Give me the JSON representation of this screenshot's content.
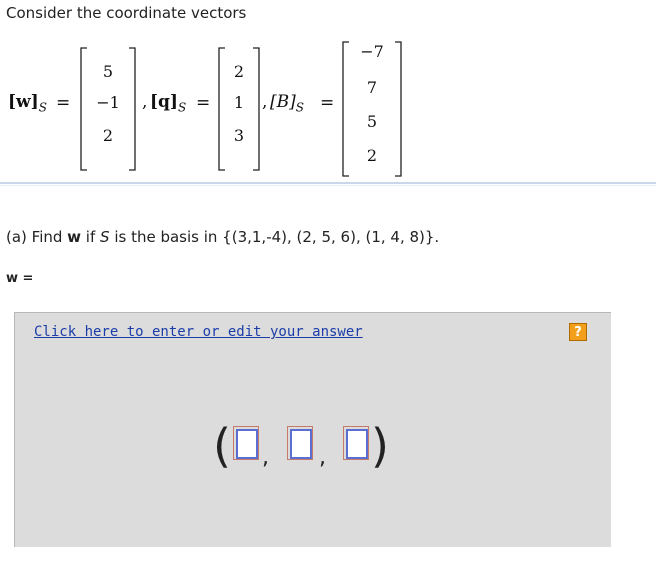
{
  "intro": "Consider the coordinate vectors",
  "vectors": {
    "w_label": "[w]",
    "w_sub": "S",
    "w": [
      "5",
      "−1",
      "2"
    ],
    "q_label": "[q]",
    "q_sub": "S",
    "q": [
      "2",
      "1",
      "3"
    ],
    "b_label": "[B]",
    "b_sub": "S",
    "b": [
      "−7",
      "7",
      "5",
      "2"
    ],
    "equals": "=",
    "comma": ","
  },
  "question": {
    "prefix": "(a) Find ",
    "bold": "w",
    "middle": " if ",
    "italic": "S",
    "suffix": " is the basis in {(3,1,-4), (2, 5, 6), (1, 4, 8)}."
  },
  "w_equals": "w =",
  "answer": {
    "link": "Click here to enter or edit your answer",
    "help": "?",
    "open_paren": "(",
    "close_paren": ")",
    "separator": ","
  },
  "colors": {
    "link": "#1c3da8",
    "help_bg": "#f2a01c",
    "panel_bg": "#dcdcdc",
    "slot_border": "#5a6fd0"
  }
}
